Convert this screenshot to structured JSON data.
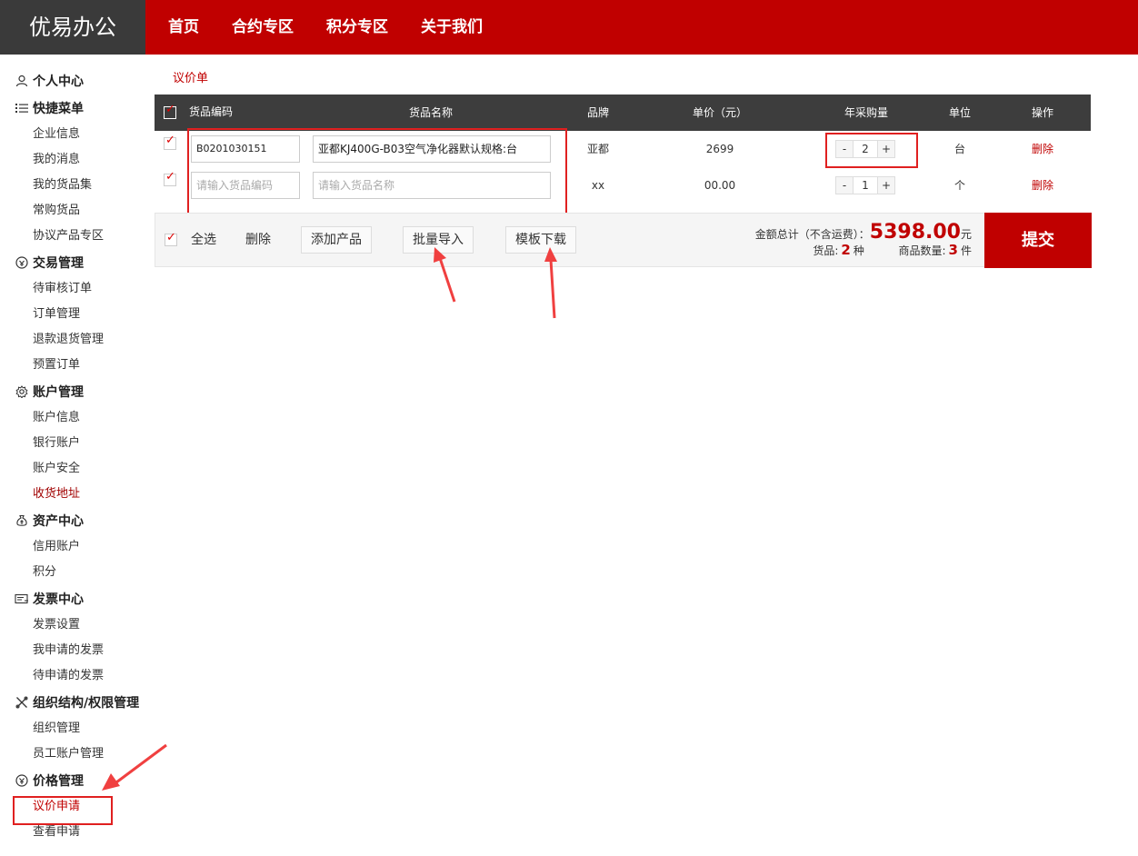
{
  "brand": {
    "logo": "优易办公"
  },
  "nav": [
    "首页",
    "合约专区",
    "积分专区",
    "关于我们"
  ],
  "sidebar": {
    "groups": [
      {
        "label": "个人中心",
        "icon": "user-icon",
        "items": []
      },
      {
        "label": "快捷菜单",
        "icon": "list-icon",
        "items": [
          "企业信息",
          "我的消息",
          "我的货品集",
          "常购货品",
          "协议产品专区"
        ]
      },
      {
        "label": "交易管理",
        "icon": "trade-icon",
        "items": [
          "待审核订单",
          "订单管理",
          "退款退货管理",
          "预置订单"
        ]
      },
      {
        "label": "账户管理",
        "icon": "gear-icon",
        "items": [
          "账户信息",
          "银行账户",
          "账户安全",
          "收货地址"
        ]
      },
      {
        "label": "资产中心",
        "icon": "money-bag-icon",
        "items": [
          "信用账户",
          "积分"
        ]
      },
      {
        "label": "发票中心",
        "icon": "invoice-icon",
        "items": [
          "发票设置",
          "我申请的发票",
          "待申请的发票"
        ]
      },
      {
        "label": "组织结构/权限管理",
        "icon": "tools-icon",
        "items": [
          "组织管理",
          "员工账户管理"
        ]
      },
      {
        "label": "价格管理",
        "icon": "price-icon",
        "items": [
          "议价申请",
          "查看申请"
        ]
      }
    ]
  },
  "breadcrumb": "议价单",
  "table": {
    "headers": {
      "code": "货品编码",
      "name": "货品名称",
      "brand": "品牌",
      "price": "单价（元）",
      "qty": "年采购量",
      "unit": "单位",
      "op": "操作"
    },
    "rows": [
      {
        "code": "B0201030151",
        "name": "亚都KJ400G-B03空气净化器默认规格:台",
        "brand": "亚都",
        "price": "2699",
        "qty": "2",
        "unit": "台",
        "op": "删除"
      },
      {
        "code_placeholder": "请输入货品编码",
        "name_placeholder": "请输入货品名称",
        "brand": "xx",
        "price": "00.00",
        "qty": "1",
        "unit": "个",
        "op": "删除"
      }
    ]
  },
  "footer": {
    "select_all": "全选",
    "delete": "删除",
    "add_product": "添加产品",
    "batch_import": "批量导入",
    "template_download": "模板下载",
    "total_label": "金额总计（不含运费）：",
    "total_amount": "5398.00",
    "currency": "元",
    "goods_label": "货品:",
    "goods_count": "2",
    "goods_unit": "种",
    "qty_label": "商品数量:",
    "qty_count": "3",
    "qty_unit": "件",
    "submit": "提交"
  },
  "stepper": {
    "minus": "-",
    "plus": "+"
  },
  "colors": {
    "brand_red": "#c00000",
    "logo_bg": "#3a3a3a",
    "header_bg": "#3d3d3d",
    "annotation_red": "#e02020"
  }
}
